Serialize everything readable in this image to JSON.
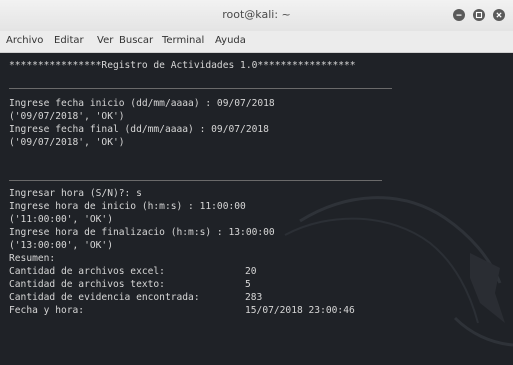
{
  "window": {
    "title": "root@kali: ~"
  },
  "menu": [
    "Archivo",
    "Editar",
    "Ver",
    "Buscar",
    "Terminal",
    "Ayuda"
  ],
  "terminal": {
    "header": "****************Registro de Actividades 1.0*****************",
    "lines": [
      "Ingrese fecha inicio (dd/mm/aaaa) : 09/07/2018",
      "('09/07/2018', 'OK')",
      "Ingrese fecha final (dd/mm/aaaa) : 09/07/2018",
      "('09/07/2018', 'OK')",
      "Ingresar hora (S/N)?: s",
      "Ingrese hora de inicio (h:m:s) : 11:00:00",
      "('11:00:00', 'OK')",
      "Ingrese hora de finalizacio (h:m:s) : 13:00:00",
      "('13:00:00', 'OK')",
      "Resumen:"
    ],
    "summary": [
      {
        "label": "Cantidad de archivos excel:",
        "value": "20"
      },
      {
        "label": "Cantidad de archivos texto:",
        "value": "5"
      },
      {
        "label": "Cantidad de evidencia encontrada:",
        "value": "283"
      },
      {
        "label": "Fecha y hora:",
        "value": "15/07/2018 23:00:46"
      }
    ]
  },
  "icons": {
    "minimize": "minimize-icon",
    "maximize": "maximize-icon",
    "close": "close-icon"
  }
}
